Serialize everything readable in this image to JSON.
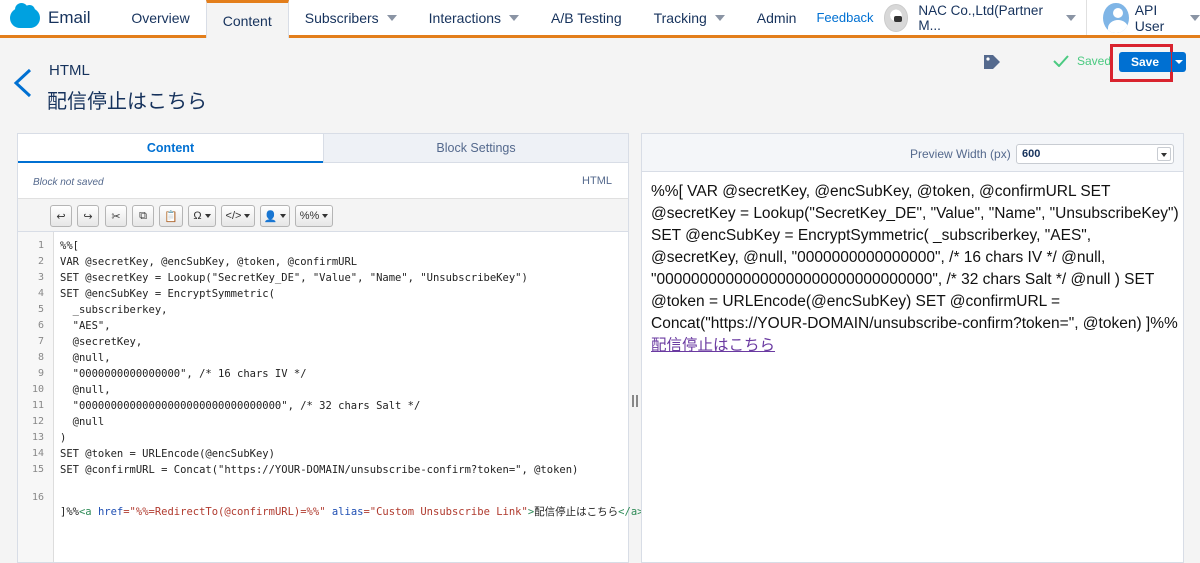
{
  "nav": {
    "brand": "Email",
    "tabs": [
      {
        "label": "Overview"
      },
      {
        "label": "Content"
      },
      {
        "label": "Subscribers"
      },
      {
        "label": "Interactions"
      },
      {
        "label": "A/B Testing"
      },
      {
        "label": "Tracking"
      },
      {
        "label": "Admin"
      }
    ],
    "feedback": "Feedback",
    "org": "NAC Co.,Ltd(Partner M...",
    "user": "API User"
  },
  "header": {
    "type": "HTML",
    "title": "配信停止はこちら",
    "saved": "Saved",
    "save": "Save"
  },
  "editor": {
    "tab_content": "Content",
    "tab_block": "Block Settings",
    "status": "Block not saved",
    "mode": "HTML",
    "toolbar": [
      "↩",
      "↪",
      "✂",
      "⧉",
      "📋",
      "Ω",
      "</>",
      "👤",
      "%%"
    ],
    "lines": [
      "%%[",
      "VAR @secretKey, @encSubKey, @token, @confirmURL",
      "SET @secretKey = Lookup(\"SecretKey_DE\", \"Value\", \"Name\", \"UnsubscribeKey\")",
      "SET @encSubKey = EncryptSymmetric(",
      "  _subscriberkey,",
      "  \"AES\",",
      "  @secretKey,",
      "  @null,",
      "  \"0000000000000000\", /* 16 chars IV */",
      "  @null,",
      "  \"00000000000000000000000000000000\", /* 32 chars Salt */",
      "  @null",
      ")",
      "SET @token = URLEncode(@encSubKey)",
      "SET @confirmURL = Concat(\"https://YOUR-DOMAIN/unsubscribe-confirm?token=\", @token)"
    ],
    "line16": {
      "a": "]%%",
      "b": "<a",
      "c": " href",
      "d": "=\"%%=RedirectTo(@confirmURL)=%%\"",
      "e": " alias",
      "f": "=\"Custom Unsubscribe Link\"",
      "g": ">",
      "h": "配信停止はこちら",
      "i": "</a>"
    }
  },
  "preview": {
    "width_label": "Preview Width (px)",
    "width_value": "600",
    "text": "%%[ VAR @secretKey, @encSubKey, @token, @confirmURL SET @secretKey = Lookup(\"SecretKey_DE\", \"Value\", \"Name\", \"UnsubscribeKey\") SET @encSubKey = EncryptSymmetric( _subscriberkey, \"AES\", @secretKey, @null, \"0000000000000000\", /* 16 chars IV */ @null, \"00000000000000000000000000000000\", /* 32 chars Salt */ @null ) SET @token = URLEncode(@encSubKey) SET @confirmURL = Concat(\"https://YOUR-DOMAIN/unsubscribe-confirm?token=\", @token) ]%%",
    "link": "配信停止はこちら"
  }
}
